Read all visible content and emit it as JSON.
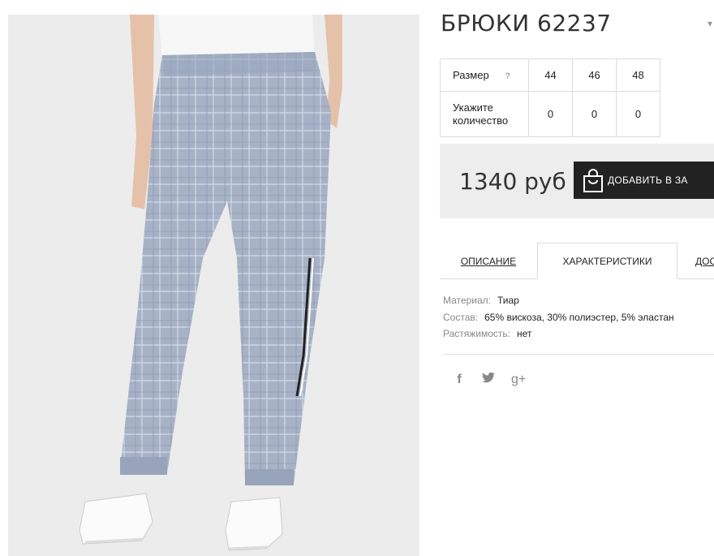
{
  "product": {
    "title": "БРЮКИ 62237"
  },
  "size_table": {
    "size_label": "Размер",
    "help_icon": "?",
    "sizes": [
      "44",
      "46",
      "48"
    ],
    "qty_label_line1": "Укажите",
    "qty_label_line2": "количество",
    "quantities": [
      "0",
      "0",
      "0"
    ]
  },
  "price": {
    "value": "1340 руб",
    "add_to_cart": "ДОБАВИТЬ В ЗА"
  },
  "tabs": {
    "description": "ОПИСАНИЕ",
    "characteristics": "ХАРАКТЕРИСТИКИ",
    "delivery": "ДОС"
  },
  "characteristics": {
    "material_key": "Материал:",
    "material_val": "Тиар",
    "composition_key": "Состав:",
    "composition_val": "65% вискоза, 30% полиэстер, 5% эластан",
    "stretch_key": "Растяжимость:",
    "stretch_val": "нет"
  },
  "social": {
    "facebook": "f",
    "twitter_icon": "twitter-icon",
    "googleplus": "g+"
  },
  "colors": {
    "button_bg": "#222222",
    "price_box_bg": "#ededed",
    "fabric": "#a9b4c8"
  }
}
